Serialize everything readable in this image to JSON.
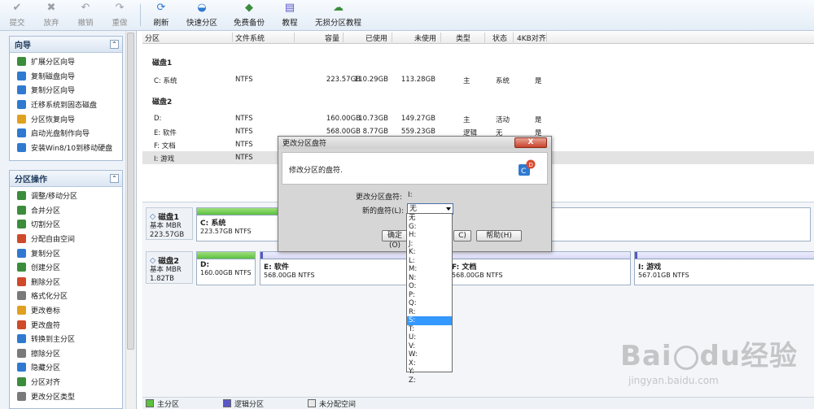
{
  "toolbar": {
    "commit": "提交",
    "discard": "放弃",
    "undo": "撤销",
    "redo": "重做",
    "refresh": "刷新",
    "quick_partition": "快速分区",
    "free_backup": "免费备份",
    "tutorial": "教程",
    "lossless_tutorial": "无损分区教程"
  },
  "sidebar": {
    "wizard_title": "向导",
    "wizard_items": [
      {
        "label": "扩展分区向导",
        "color": "#3b8d3b"
      },
      {
        "label": "复制磁盘向导",
        "color": "#2f7ad0"
      },
      {
        "label": "复制分区向导",
        "color": "#2f7ad0"
      },
      {
        "label": "迁移系统到固态磁盘",
        "color": "#2f7ad0"
      },
      {
        "label": "分区恢复向导",
        "color": "#e0a020"
      },
      {
        "label": "启动光盘制作向导",
        "color": "#2f7ad0"
      },
      {
        "label": "安装Win8/10到移动硬盘",
        "color": "#2f7ad0"
      }
    ],
    "ops_title": "分区操作",
    "ops_items": [
      {
        "label": "调整/移动分区",
        "color": "#3b8d3b"
      },
      {
        "label": "合并分区",
        "color": "#3b8d3b"
      },
      {
        "label": "切割分区",
        "color": "#3b8d3b"
      },
      {
        "label": "分配自由空间",
        "color": "#cf4a2a"
      },
      {
        "label": "复制分区",
        "color": "#2f7ad0"
      },
      {
        "label": "创建分区",
        "color": "#3b8d3b"
      },
      {
        "label": "删除分区",
        "color": "#cf4a2a"
      },
      {
        "label": "格式化分区",
        "color": "#7a7a7a"
      },
      {
        "label": "更改卷标",
        "color": "#e0a020"
      },
      {
        "label": "更改盘符",
        "color": "#cf4a2a"
      },
      {
        "label": "转换到主分区",
        "color": "#2f7ad0"
      },
      {
        "label": "擦除分区",
        "color": "#7a7a7a"
      },
      {
        "label": "隐藏分区",
        "color": "#2f7ad0"
      },
      {
        "label": "分区对齐",
        "color": "#3b8d3b"
      },
      {
        "label": "更改分区类型",
        "color": "#7a7a7a"
      }
    ]
  },
  "table": {
    "headers": [
      "分区",
      "文件系统",
      "容量",
      "已使用",
      "未使用",
      "类型",
      "状态",
      "4KB对齐"
    ],
    "disk1_label": "磁盘1",
    "disk2_label": "磁盘2",
    "disk1_rows": [
      [
        "C: 系统",
        "NTFS",
        "223.57GB",
        "110.29GB",
        "113.28GB",
        "主",
        "系统",
        "是"
      ]
    ],
    "disk2_rows": [
      [
        "D:",
        "NTFS",
        "160.00GB",
        "10.73GB",
        "149.27GB",
        "主",
        "活动",
        "是"
      ],
      [
        "E: 软件",
        "NTFS",
        "568.00GB",
        "8.77GB",
        "559.23GB",
        "逻辑",
        "无",
        "是"
      ],
      [
        "F: 文档",
        "NTFS",
        "",
        "",
        "",
        "",
        "",
        "是"
      ],
      [
        "I: 游戏",
        "NTFS",
        "",
        "",
        "",
        "",
        "",
        ""
      ]
    ]
  },
  "disks": {
    "disk1": {
      "name": "磁盘1",
      "type": "基本 MBR",
      "size": "223.57GB",
      "parts": [
        {
          "name": "C: 系统",
          "size": "223.57GB NTFS"
        }
      ]
    },
    "disk2": {
      "name": "磁盘2",
      "type": "基本 MBR",
      "size": "1.82TB",
      "parts": [
        {
          "name": "D:",
          "size": "160.00GB NTFS"
        },
        {
          "name": "E: 软件",
          "size": "568.00GB NTFS"
        },
        {
          "name": "F: 文档",
          "size": "568.00GB NTFS"
        },
        {
          "name": "I: 游戏",
          "size": "567.01GB NTFS"
        }
      ]
    }
  },
  "legend": {
    "primary": "主分区",
    "logical": "逻辑分区",
    "unallocated": "未分配空间"
  },
  "dialog": {
    "title": "更改分区盘符",
    "close": "X",
    "header": "修改分区的盘符.",
    "current_label": "更改分区盘符:",
    "current_value": "I:",
    "new_label": "新的盘符(L):",
    "new_value": "无",
    "ok": "确定(O)",
    "cancel": "C)",
    "help": "帮助(H)"
  },
  "dropdown": {
    "options": [
      "无",
      "G:",
      "H:",
      "J:",
      "K:",
      "L:",
      "M:",
      "N:",
      "O:",
      "P:",
      "Q:",
      "R:",
      "S:",
      "T:",
      "U:",
      "V:",
      "W:",
      "X:",
      "Y:",
      "Z:"
    ],
    "highlighted": "S:"
  },
  "watermark": {
    "brand": "Bai",
    "brand2": "经验",
    "url": "jingyan.baidu.com"
  },
  "colors": {
    "primary": "#5cc040",
    "logical": "#5a56c8",
    "unallocated": "#e8e8e8",
    "highlight": "#3399ff"
  }
}
